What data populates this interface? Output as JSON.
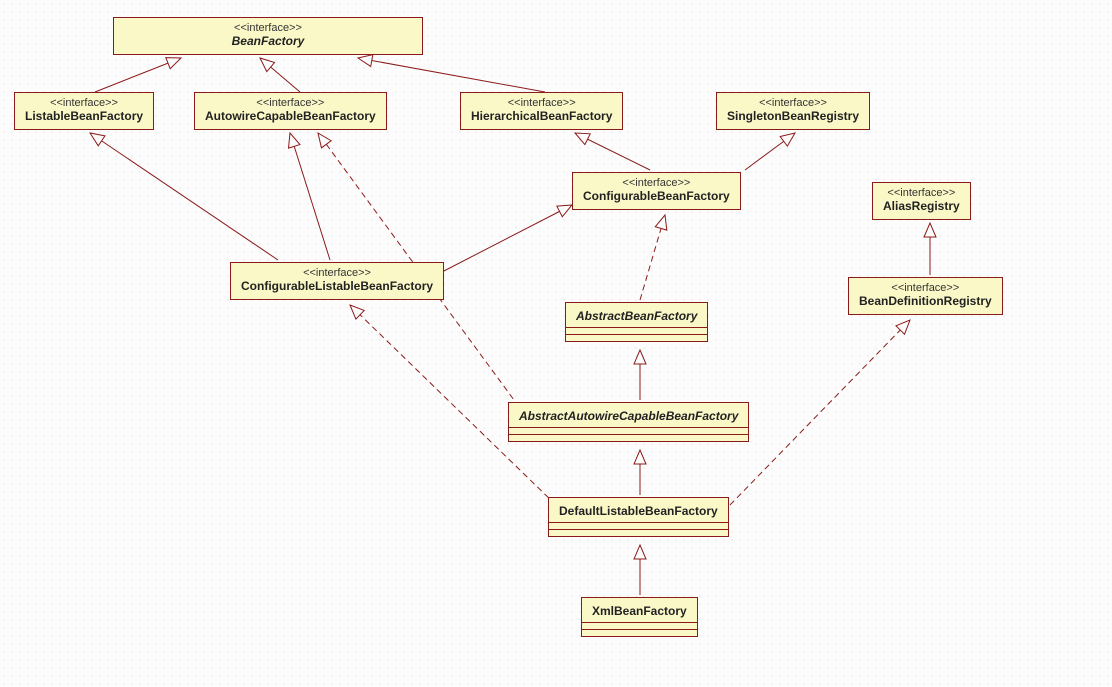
{
  "stereotype": "<<interface>>",
  "nodes": {
    "BeanFactory": "BeanFactory",
    "ListableBeanFactory": "ListableBeanFactory",
    "AutowireCapableBeanFactory": "AutowireCapableBeanFactory",
    "HierarchicalBeanFactory": "HierarchicalBeanFactory",
    "SingletonBeanRegistry": "SingletonBeanRegistry",
    "ConfigurableBeanFactory": "ConfigurableBeanFactory",
    "AliasRegistry": "AliasRegistry",
    "ConfigurableListableBeanFactory": "ConfigurableListableBeanFactory",
    "BeanDefinitionRegistry": "BeanDefinitionRegistry",
    "AbstractBeanFactory": "AbstractBeanFactory",
    "AbstractAutowireCapableBeanFactory": "AbstractAutowireCapableBeanFactory",
    "DefaultListableBeanFactory": "DefaultListableBeanFactory",
    "XmlBeanFactory": "XmlBeanFactory"
  },
  "chart_data": {
    "type": "uml-class-diagram",
    "nodes": [
      {
        "id": "BeanFactory",
        "kind": "interface",
        "abstract": true
      },
      {
        "id": "ListableBeanFactory",
        "kind": "interface"
      },
      {
        "id": "AutowireCapableBeanFactory",
        "kind": "interface"
      },
      {
        "id": "HierarchicalBeanFactory",
        "kind": "interface"
      },
      {
        "id": "SingletonBeanRegistry",
        "kind": "interface"
      },
      {
        "id": "ConfigurableBeanFactory",
        "kind": "interface"
      },
      {
        "id": "AliasRegistry",
        "kind": "interface"
      },
      {
        "id": "ConfigurableListableBeanFactory",
        "kind": "interface"
      },
      {
        "id": "BeanDefinitionRegistry",
        "kind": "interface"
      },
      {
        "id": "AbstractBeanFactory",
        "kind": "abstract-class",
        "abstract": true
      },
      {
        "id": "AbstractAutowireCapableBeanFactory",
        "kind": "abstract-class",
        "abstract": true
      },
      {
        "id": "DefaultListableBeanFactory",
        "kind": "class"
      },
      {
        "id": "XmlBeanFactory",
        "kind": "class"
      }
    ],
    "edges": [
      {
        "from": "ListableBeanFactory",
        "to": "BeanFactory",
        "rel": "extends"
      },
      {
        "from": "AutowireCapableBeanFactory",
        "to": "BeanFactory",
        "rel": "extends"
      },
      {
        "from": "HierarchicalBeanFactory",
        "to": "BeanFactory",
        "rel": "extends"
      },
      {
        "from": "ConfigurableBeanFactory",
        "to": "HierarchicalBeanFactory",
        "rel": "extends"
      },
      {
        "from": "ConfigurableBeanFactory",
        "to": "SingletonBeanRegistry",
        "rel": "extends"
      },
      {
        "from": "ConfigurableListableBeanFactory",
        "to": "ListableBeanFactory",
        "rel": "extends"
      },
      {
        "from": "ConfigurableListableBeanFactory",
        "to": "AutowireCapableBeanFactory",
        "rel": "extends"
      },
      {
        "from": "ConfigurableListableBeanFactory",
        "to": "ConfigurableBeanFactory",
        "rel": "extends"
      },
      {
        "from": "BeanDefinitionRegistry",
        "to": "AliasRegistry",
        "rel": "extends"
      },
      {
        "from": "AbstractBeanFactory",
        "to": "ConfigurableBeanFactory",
        "rel": "implements"
      },
      {
        "from": "AbstractAutowireCapableBeanFactory",
        "to": "AbstractBeanFactory",
        "rel": "extends"
      },
      {
        "from": "AbstractAutowireCapableBeanFactory",
        "to": "AutowireCapableBeanFactory",
        "rel": "implements"
      },
      {
        "from": "DefaultListableBeanFactory",
        "to": "AbstractAutowireCapableBeanFactory",
        "rel": "extends"
      },
      {
        "from": "DefaultListableBeanFactory",
        "to": "ConfigurableListableBeanFactory",
        "rel": "implements"
      },
      {
        "from": "DefaultListableBeanFactory",
        "to": "BeanDefinitionRegistry",
        "rel": "implements"
      },
      {
        "from": "XmlBeanFactory",
        "to": "DefaultListableBeanFactory",
        "rel": "extends"
      }
    ]
  }
}
